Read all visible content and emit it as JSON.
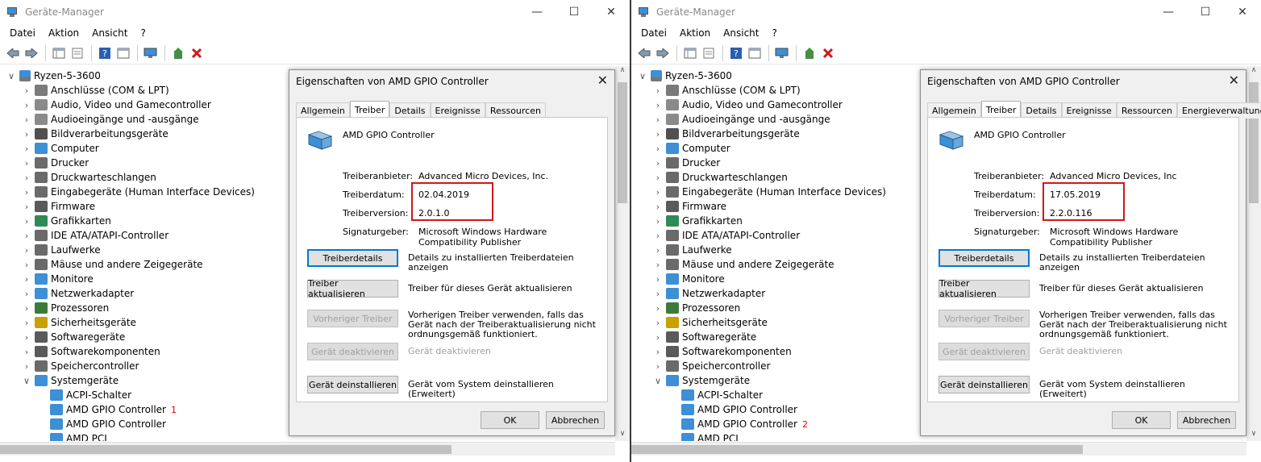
{
  "windows": [
    {
      "title": "Geräte-Manager",
      "controls": {
        "minimize": "—",
        "maximize": "☐",
        "close": "✕"
      },
      "menu": [
        "Datei",
        "Aktion",
        "Ansicht",
        "?"
      ],
      "tree": {
        "root": "Ryzen-5-3600",
        "categories": [
          {
            "label": "Anschlüsse (COM & LPT)",
            "icon": "port-icon",
            "color": "#7a7a7a"
          },
          {
            "label": "Audio, Video und Gamecontroller",
            "icon": "speaker-icon",
            "color": "#8a8a8a"
          },
          {
            "label": "Audioeingänge und -ausgänge",
            "icon": "speaker-icon",
            "color": "#8a8a8a"
          },
          {
            "label": "Bildverarbeitungsgeräte",
            "icon": "camera-icon",
            "color": "#505050"
          },
          {
            "label": "Computer",
            "icon": "monitor-icon",
            "color": "#3d8fd6"
          },
          {
            "label": "Drucker",
            "icon": "printer-icon",
            "color": "#6a6a6a"
          },
          {
            "label": "Druckwarteschlangen",
            "icon": "printer-icon",
            "color": "#6a6a6a"
          },
          {
            "label": "Eingabegeräte (Human Interface Devices)",
            "icon": "hid-icon",
            "color": "#6a6a6a"
          },
          {
            "label": "Firmware",
            "icon": "firmware-icon",
            "color": "#5a5a5a"
          },
          {
            "label": "Grafikkarten",
            "icon": "gpu-icon",
            "color": "#2e8b57"
          },
          {
            "label": "IDE ATA/ATAPI-Controller",
            "icon": "ide-icon",
            "color": "#6a6a6a"
          },
          {
            "label": "Laufwerke",
            "icon": "drive-icon",
            "color": "#6a6a6a"
          },
          {
            "label": "Mäuse und andere Zeigegeräte",
            "icon": "mouse-icon",
            "color": "#6a6a6a"
          },
          {
            "label": "Monitore",
            "icon": "monitor-icon",
            "color": "#3d8fd6"
          },
          {
            "label": "Netzwerkadapter",
            "icon": "network-icon",
            "color": "#3d8fd6"
          },
          {
            "label": "Prozessoren",
            "icon": "cpu-icon",
            "color": "#3c7a3c"
          },
          {
            "label": "Sicherheitsgeräte",
            "icon": "key-icon",
            "color": "#c8a000"
          },
          {
            "label": "Softwaregeräte",
            "icon": "software-icon",
            "color": "#5a5a5a"
          },
          {
            "label": "Softwarekomponenten",
            "icon": "software-icon",
            "color": "#5a5a5a"
          },
          {
            "label": "Speichercontroller",
            "icon": "storage-icon",
            "color": "#6a6a6a"
          },
          {
            "label": "Systemgeräte",
            "icon": "system-icon",
            "color": "#3d8fd6"
          }
        ],
        "children": [
          "ACPI-Schalter",
          "AMD GPIO Controller",
          "AMD GPIO Controller",
          "AMD PCI"
        ],
        "marker": "1",
        "marker_index": 1
      },
      "dialog": {
        "title": "Eigenschaften von AMD GPIO Controller",
        "close": "✕",
        "tabs": [
          "Allgemein",
          "Treiber",
          "Details",
          "Ereignisse",
          "Ressourcen"
        ],
        "active_tab": "Treiber",
        "device_name": "AMD GPIO Controller",
        "provider_label": "Treiberanbieter:",
        "provider": "Advanced Micro Devices, Inc.",
        "date_label": "Treiberdatum:",
        "date": "02.04.2019",
        "version_label": "Treiberversion:",
        "version": "2.0.1.0",
        "signer_label": "Signaturgeber:",
        "signer": "Microsoft Windows Hardware Compatibility Publisher",
        "buttons": [
          {
            "label": "Treiberdetails",
            "desc": "Details zu installierten Treiberdateien anzeigen"
          },
          {
            "label": "Treiber aktualisieren",
            "desc": "Treiber für dieses Gerät aktualisieren"
          },
          {
            "label": "Vorheriger Treiber",
            "desc": "Vorherigen Treiber verwenden, falls das Gerät nach der Treiberaktualisierung nicht ordnungsgemäß funktioniert."
          },
          {
            "label": "Gerät deaktivieren",
            "desc": "Gerät deaktivieren"
          },
          {
            "label": "Gerät deinstallieren",
            "desc": "Gerät vom System deinstallieren (Erweitert)"
          }
        ],
        "ok": "OK",
        "cancel": "Abbrechen"
      }
    },
    {
      "title": "Geräte-Manager",
      "controls": {
        "minimize": "—",
        "maximize": "☐",
        "close": "✕"
      },
      "menu": [
        "Datei",
        "Aktion",
        "Ansicht",
        "?"
      ],
      "tree": {
        "root": "Ryzen-5-3600",
        "categories": [
          {
            "label": "Anschlüsse (COM & LPT)",
            "icon": "port-icon",
            "color": "#7a7a7a"
          },
          {
            "label": "Audio, Video und Gamecontroller",
            "icon": "speaker-icon",
            "color": "#8a8a8a"
          },
          {
            "label": "Audioeingänge und -ausgänge",
            "icon": "speaker-icon",
            "color": "#8a8a8a"
          },
          {
            "label": "Bildverarbeitungsgeräte",
            "icon": "camera-icon",
            "color": "#505050"
          },
          {
            "label": "Computer",
            "icon": "monitor-icon",
            "color": "#3d8fd6"
          },
          {
            "label": "Drucker",
            "icon": "printer-icon",
            "color": "#6a6a6a"
          },
          {
            "label": "Druckwarteschlangen",
            "icon": "printer-icon",
            "color": "#6a6a6a"
          },
          {
            "label": "Eingabegeräte (Human Interface Devices)",
            "icon": "hid-icon",
            "color": "#6a6a6a"
          },
          {
            "label": "Firmware",
            "icon": "firmware-icon",
            "color": "#5a5a5a"
          },
          {
            "label": "Grafikkarten",
            "icon": "gpu-icon",
            "color": "#2e8b57"
          },
          {
            "label": "IDE ATA/ATAPI-Controller",
            "icon": "ide-icon",
            "color": "#6a6a6a"
          },
          {
            "label": "Laufwerke",
            "icon": "drive-icon",
            "color": "#6a6a6a"
          },
          {
            "label": "Mäuse und andere Zeigegeräte",
            "icon": "mouse-icon",
            "color": "#6a6a6a"
          },
          {
            "label": "Monitore",
            "icon": "monitor-icon",
            "color": "#3d8fd6"
          },
          {
            "label": "Netzwerkadapter",
            "icon": "network-icon",
            "color": "#3d8fd6"
          },
          {
            "label": "Prozessoren",
            "icon": "cpu-icon",
            "color": "#3c7a3c"
          },
          {
            "label": "Sicherheitsgeräte",
            "icon": "key-icon",
            "color": "#c8a000"
          },
          {
            "label": "Softwaregeräte",
            "icon": "software-icon",
            "color": "#5a5a5a"
          },
          {
            "label": "Softwarekomponenten",
            "icon": "software-icon",
            "color": "#5a5a5a"
          },
          {
            "label": "Speichercontroller",
            "icon": "storage-icon",
            "color": "#6a6a6a"
          },
          {
            "label": "Systemgeräte",
            "icon": "system-icon",
            "color": "#3d8fd6"
          }
        ],
        "children": [
          "ACPI-Schalter",
          "AMD GPIO Controller",
          "AMD GPIO Controller",
          "AMD PCI"
        ],
        "marker": "2",
        "marker_index": 2
      },
      "dialog": {
        "title": "Eigenschaften von AMD GPIO Controller",
        "close": "✕",
        "tabs": [
          "Allgemein",
          "Treiber",
          "Details",
          "Ereignisse",
          "Ressourcen",
          "Energieverwaltung"
        ],
        "active_tab": "Treiber",
        "device_name": "AMD GPIO Controller",
        "provider_label": "Treiberanbieter:",
        "provider": "Advanced Micro Devices, Inc",
        "date_label": "Treiberdatum:",
        "date": "17.05.2019",
        "version_label": "Treiberversion:",
        "version": "2.2.0.116",
        "signer_label": "Signaturgeber:",
        "signer": "Microsoft Windows Hardware Compatibility Publisher",
        "buttons": [
          {
            "label": "Treiberdetails",
            "desc": "Details zu installierten Treiberdateien anzeigen"
          },
          {
            "label": "Treiber aktualisieren",
            "desc": "Treiber für dieses Gerät aktualisieren"
          },
          {
            "label": "Vorheriger Treiber",
            "desc": "Vorherigen Treiber verwenden, falls das Gerät nach der Treiberaktualisierung nicht ordnungsgemäß funktioniert."
          },
          {
            "label": "Gerät deaktivieren",
            "desc": "Gerät deaktivieren"
          },
          {
            "label": "Gerät deinstallieren",
            "desc": "Gerät vom System deinstallieren (Erweitert)"
          }
        ],
        "ok": "OK",
        "cancel": "Abbrechen"
      }
    }
  ],
  "colors": {
    "highlight": "#d01818",
    "accent": "#0078d7",
    "disabled_text": "#a0a0a0"
  }
}
